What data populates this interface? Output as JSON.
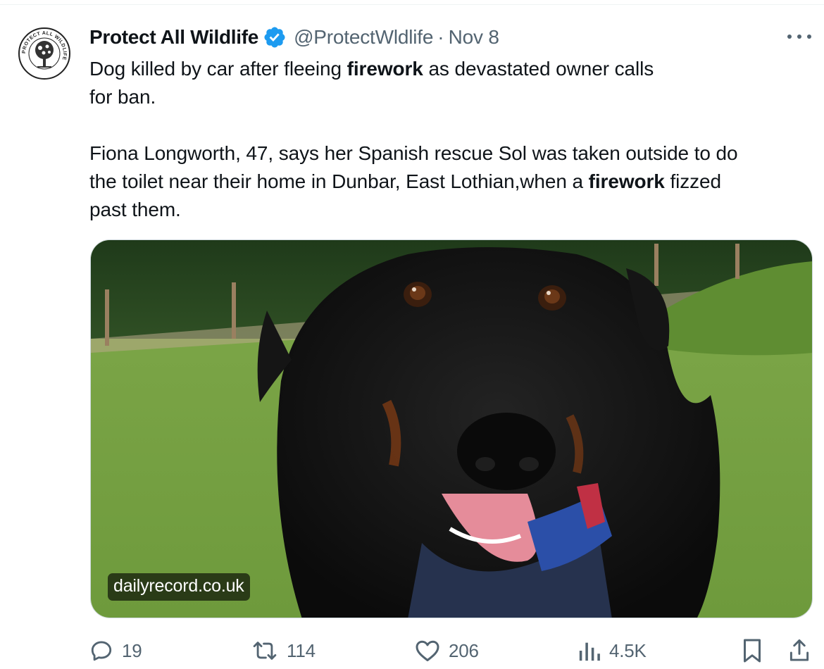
{
  "tweet": {
    "display_name": "Protect All Wildlife",
    "handle": "@ProtectWldlife",
    "separator": "·",
    "date": "Nov 8",
    "avatar_text": "PROTECT ALL WILDLIFE",
    "paragraph1": {
      "t1": "Dog killed by car after fleeing ",
      "b1": "firework",
      "t2": " as devastated owner calls",
      "t3": "for ban."
    },
    "paragraph2": {
      "t1": "Fiona Longworth, 47, says her Spanish rescue Sol was taken outside to do",
      "t2": "the toilet near their home in Dunbar, East Lothian,when a ",
      "b1": "firework",
      "t3": " fizzed",
      "t4": "past them."
    },
    "link_source": "dailyrecord.co.uk"
  },
  "actions": {
    "replies": "19",
    "reposts": "114",
    "likes": "206",
    "views": "4.5K"
  },
  "icons": {
    "verified": "verified-badge-icon",
    "more": "more-icon",
    "reply": "reply-icon",
    "repost": "repost-icon",
    "like": "heart-icon",
    "views": "views-icon",
    "bookmark": "bookmark-icon",
    "share": "share-icon"
  },
  "colors": {
    "accent": "#1d9bf0",
    "text": "#0f1419",
    "muted": "#536471",
    "border": "#cfd9de"
  }
}
